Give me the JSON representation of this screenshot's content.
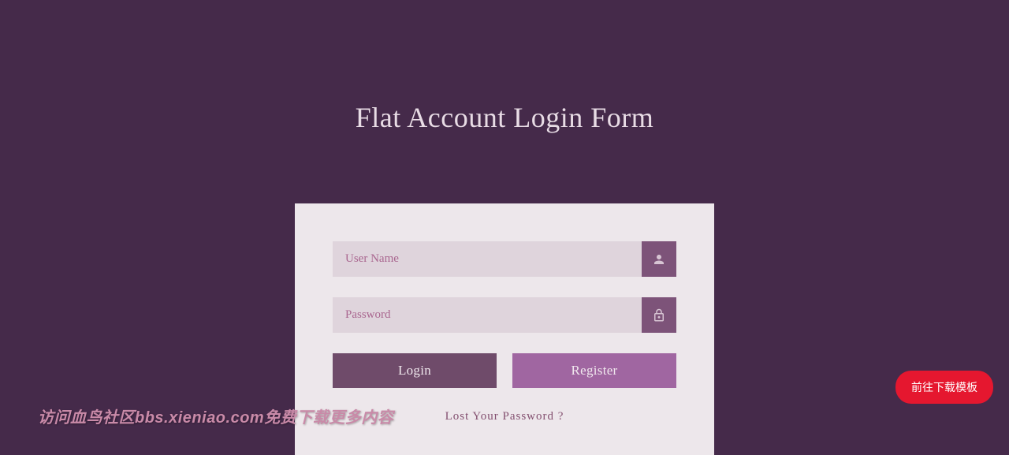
{
  "header": {
    "title": "Flat Account Login Form"
  },
  "form": {
    "username": {
      "placeholder": "User Name"
    },
    "password": {
      "placeholder": "Password"
    },
    "login_label": "Login",
    "register_label": "Register",
    "lost_password_label": "Lost Your Password ?"
  },
  "watermark": {
    "text": "访问血鸟社区bbs.xieniao.com免费下载更多内容"
  },
  "download": {
    "label": "前往下载模板"
  }
}
